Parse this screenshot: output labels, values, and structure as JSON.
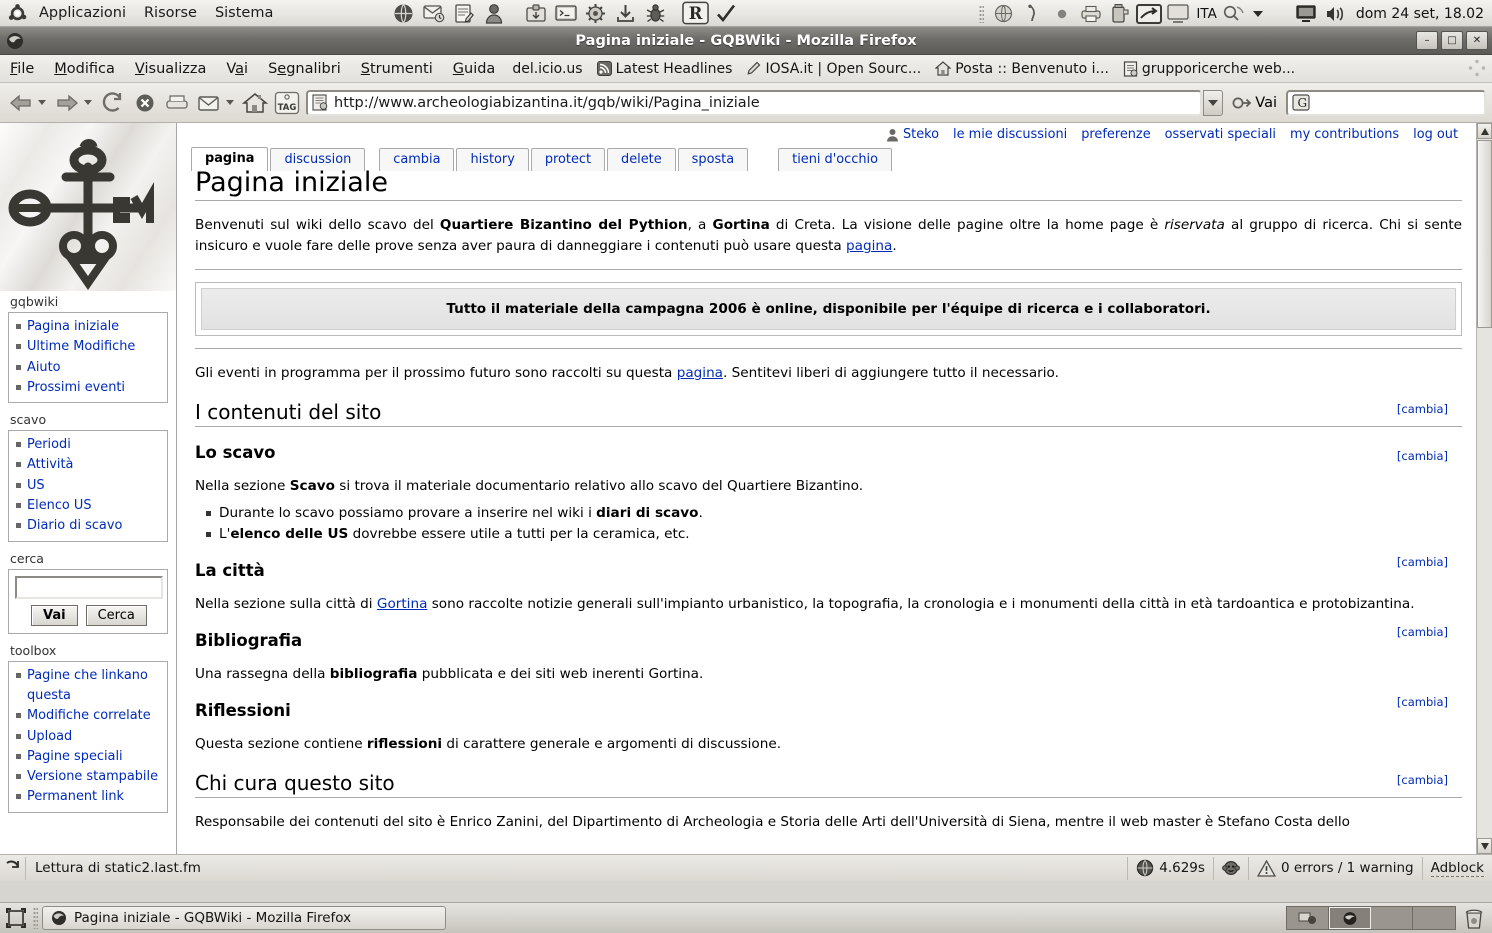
{
  "desktop": {
    "panel_menus": [
      "Applicazioni",
      "Risorse",
      "Sistema"
    ],
    "launcher_icons": [
      "web-browser-icon",
      "email-icon",
      "notes-icon",
      "user-icon",
      "archive-icon",
      "terminal-icon",
      "settings-icon",
      "download-icon",
      "bug-icon",
      "r-logo-icon",
      "checkmark-icon"
    ],
    "tray_icons": [
      "globe-icon",
      "pointer-icon",
      "dot-icon",
      "printer-icon",
      "battery-icon",
      "network-icon",
      "display-icon"
    ],
    "keyboard_layout": "ITA",
    "tray_right_icons": [
      "monitor-icon",
      "volume-icon"
    ],
    "clock": "dom 24 set, 18.02"
  },
  "window": {
    "title": "Pagina iniziale - GQBWiki - Mozilla Firefox",
    "minimize": "–",
    "maximize": "□",
    "close": "✕"
  },
  "menubar": {
    "items": [
      {
        "label": "File",
        "accel": "F"
      },
      {
        "label": "Modifica",
        "accel": "M"
      },
      {
        "label": "Visualizza",
        "accel": "V"
      },
      {
        "label": "Vai",
        "accel": "a"
      },
      {
        "label": "Segnalibri",
        "accel": "S"
      },
      {
        "label": "Strumenti",
        "accel": "S"
      },
      {
        "label": "Guida",
        "accel": "G"
      }
    ],
    "bookmarks": [
      {
        "label": "del.icio.us",
        "icon": "none"
      },
      {
        "label": "Latest Headlines",
        "icon": "rss-icon"
      },
      {
        "label": "IOSA.it | Open Sourc...",
        "icon": "pen-icon"
      },
      {
        "label": "Posta :: Benvenuto i...",
        "icon": "home-icon"
      },
      {
        "label": "grupporicerche web...",
        "icon": "page-icon"
      }
    ]
  },
  "navbar": {
    "back": "back-icon",
    "forward": "forward-icon",
    "reload": "reload-icon",
    "stop": "stop-icon",
    "print": "print-icon",
    "mail": "mail-icon",
    "home": "home-icon",
    "tag": "TAG",
    "url": "http://www.archeologiabizantina.it/gqb/wiki/Pagina_iniziale",
    "go_label": "Vai",
    "search_placeholder": "",
    "search_value": ""
  },
  "wiki": {
    "user_links": [
      {
        "label": "Steko",
        "icon": "user-icon"
      },
      {
        "label": "le mie discussioni"
      },
      {
        "label": "preferenze"
      },
      {
        "label": "osservati speciali"
      },
      {
        "label": "my contributions"
      },
      {
        "label": "log out"
      }
    ],
    "tabs": [
      {
        "label": "pagina",
        "selected": true
      },
      {
        "label": "discussion",
        "selected": false
      },
      {
        "label": "cambia",
        "selected": false,
        "gap": 1
      },
      {
        "label": "history",
        "selected": false
      },
      {
        "label": "protect",
        "selected": false
      },
      {
        "label": "delete",
        "selected": false
      },
      {
        "label": "sposta",
        "selected": false
      },
      {
        "label": "tieni d'occhio",
        "selected": false,
        "gap": 2
      }
    ],
    "sidebar": {
      "logo_alt": "gqbwiki-cross-logo",
      "portals": [
        {
          "heading": "gqbwiki",
          "items": [
            "Pagina iniziale",
            "Ultime Modifiche",
            "Aiuto",
            "Prossimi eventi"
          ]
        },
        {
          "heading": "scavo",
          "items": [
            "Periodi",
            "Attività",
            "US",
            "Elenco US",
            "Diario di scavo"
          ]
        }
      ],
      "search": {
        "heading": "cerca",
        "value": "",
        "go_label": "Vai",
        "search_label": "Cerca"
      },
      "toolbox": {
        "heading": "toolbox",
        "items": [
          "Pagine che linkano questa",
          "Modifiche correlate",
          "Upload",
          "Pagine speciali",
          "Versione stampabile",
          "Permanent link"
        ]
      }
    },
    "page": {
      "title": "Pagina iniziale",
      "intro_1": "Benvenuti sul wiki dello scavo del ",
      "intro_b1": "Quartiere Bizantino del Pythion",
      "intro_2": ", a ",
      "intro_b2": "Gortina",
      "intro_3": " di Creta. La visione delle pagine oltre la home page è ",
      "intro_i1": "riservata",
      "intro_4": " al gruppo di ricerca. Chi si sente insicuro e vuole fare delle prove senza aver paura di danneggiare i contenuti può usare questa ",
      "intro_link": "pagina",
      "intro_5": ".",
      "notice": "Tutto il materiale della campagna 2006 è online, disponibile per l'équipe di ricerca e i collaboratori.",
      "events_1": "Gli eventi in programma per il prossimo futuro sono raccolti su questa ",
      "events_link": "pagina",
      "events_2": ". Sentitevi liberi di aggiungere tutto il necessario.",
      "edit_label": "[cambia]",
      "h2_contenuti": "I contenuti del sito",
      "h3_scavo": "Lo scavo",
      "scavo_1": "Nella sezione ",
      "scavo_b1": "Scavo",
      "scavo_2": " si trova il materiale documentario relativo allo scavo del Quartiere Bizantino.",
      "scavo_li1_a": "Durante lo scavo possiamo provare a inserire nel wiki i ",
      "scavo_li1_b": "diari di scavo",
      "scavo_li1_c": ".",
      "scavo_li2_a": "L'",
      "scavo_li2_b": "elenco delle US",
      "scavo_li2_c": " dovrebbe essere utile a tutti per la ceramica, etc.",
      "h3_citta": "La città",
      "citta_1": "Nella sezione sulla città di ",
      "citta_link": "Gortina",
      "citta_2": " sono raccolte notizie generali sull'impianto urbanistico, la topografia, la cronologia e i monumenti della città in età tardoantica e protobizantina.",
      "h3_biblio": "Bibliografia",
      "biblio_1": "Una rassegna della ",
      "biblio_b1": "bibliografia",
      "biblio_2": " pubblicata e dei siti web inerenti Gortina.",
      "h3_rifl": "Riflessioni",
      "rifl_1": "Questa sezione contiene ",
      "rifl_b1": "riflessioni",
      "rifl_2": " di carattere generale e argomenti di discussione.",
      "h2_chicura": "Chi cura questo sito",
      "chicura_cut": "Responsabile dei contenuti del sito è Enrico Zanini, del Dipartimento di Archeologia e Storia delle Arti dell'Università di Siena, mentre il web master è Stefano Costa dello"
    }
  },
  "statusbar": {
    "status_text": "Lettura di static2.last.fm",
    "load_time": "4.629s",
    "errors": "0 errors / 1 warning",
    "adblock": "Adblock",
    "icons": [
      "loading-icon",
      "globe-timer-icon",
      "monkey-icon",
      "warning-icon"
    ]
  },
  "taskbar": {
    "show_desktop": "show-desktop-icon",
    "tasks": [
      {
        "label": "Pagina iniziale - GQBWiki - Mozilla Firefox",
        "icon": "firefox-icon",
        "active": true
      }
    ],
    "workspaces": 4,
    "active_workspace": 2,
    "trash": "trash-icon"
  }
}
